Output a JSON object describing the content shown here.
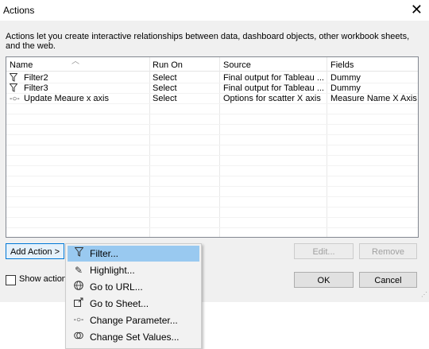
{
  "window": {
    "title": "Actions",
    "close_glyph": "✕"
  },
  "description": "Actions let you create interactive relationships between data, dashboard objects, other workbook sheets, and the web.",
  "table": {
    "columns": [
      "Name",
      "Run On",
      "Source",
      "Fields"
    ],
    "rows": [
      {
        "icon": "filter-icon",
        "name": "Filter2",
        "run_on": "Select",
        "source": "Final output for Tableau ...",
        "fields": "Dummy"
      },
      {
        "icon": "filter-icon",
        "name": "Filter3",
        "run_on": "Select",
        "source": "Final output for Tableau ...",
        "fields": "Dummy"
      },
      {
        "icon": "parameter-icon",
        "name": "Update Meaure x axis",
        "run_on": "Select",
        "source": "Options for scatter X axis",
        "fields": "Measure Name X Axis"
      }
    ]
  },
  "buttons": {
    "add_action": "Add Action >",
    "edit": "Edit...",
    "remove": "Remove",
    "ok": "OK",
    "cancel": "Cancel"
  },
  "show_action_checkbox": {
    "label": "Show action",
    "checked": false
  },
  "menu": {
    "items": [
      {
        "icon": "filter-icon",
        "label": "Filter...",
        "highlighted": true
      },
      {
        "icon": "highlight-icon",
        "label": "Highlight...",
        "highlighted": false
      },
      {
        "icon": "globe-icon",
        "label": "Go to URL...",
        "highlighted": false
      },
      {
        "icon": "go-to-sheet-icon",
        "label": "Go to Sheet...",
        "highlighted": false
      },
      {
        "icon": "parameter-icon",
        "label": "Change Parameter...",
        "highlighted": false
      },
      {
        "icon": "set-values-icon",
        "label": "Change Set Values...",
        "highlighted": false
      }
    ]
  }
}
